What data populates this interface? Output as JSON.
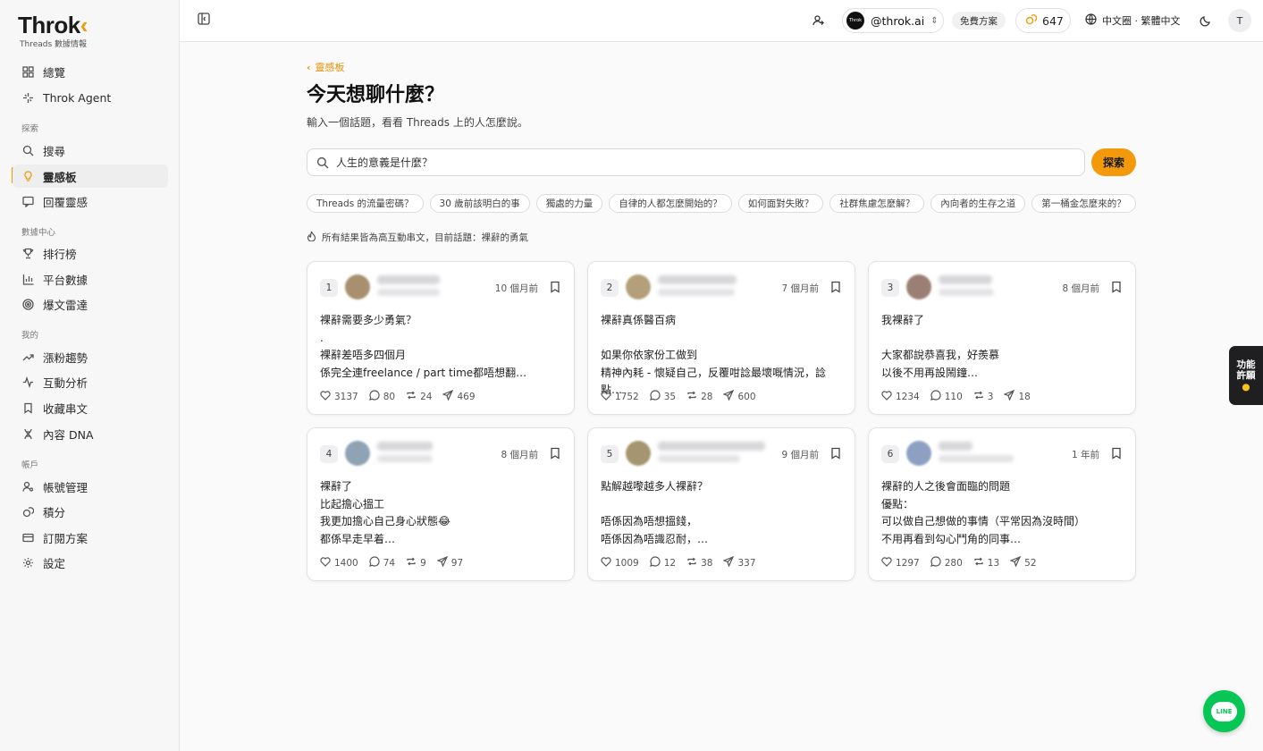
{
  "app": {
    "logo_main": "Throk",
    "logo_accent": "‹",
    "logo_sub": "Threads 數據情報"
  },
  "sidebar": {
    "top_items": [
      {
        "label": "總覽",
        "icon": "grid-icon"
      },
      {
        "label": "Throk Agent",
        "icon": "sparkle-icon"
      }
    ],
    "sections": [
      {
        "title": "探索",
        "items": [
          {
            "label": "搜尋",
            "icon": "search-icon"
          },
          {
            "label": "靈感板",
            "icon": "lightbulb-icon",
            "active": true
          },
          {
            "label": "回覆靈感",
            "icon": "reply-icon"
          }
        ]
      },
      {
        "title": "數據中心",
        "items": [
          {
            "label": "排行榜",
            "icon": "trophy-icon"
          },
          {
            "label": "平台數據",
            "icon": "bar-chart-icon"
          },
          {
            "label": "爆文雷達",
            "icon": "radar-icon"
          }
        ]
      },
      {
        "title": "我的",
        "items": [
          {
            "label": "漲粉趨勢",
            "icon": "trend-up-icon"
          },
          {
            "label": "互動分析",
            "icon": "activity-icon"
          },
          {
            "label": "收藏串文",
            "icon": "bookmark-icon"
          },
          {
            "label": "內容 DNA",
            "icon": "dna-icon"
          }
        ]
      },
      {
        "title": "帳戶",
        "items": [
          {
            "label": "帳號管理",
            "icon": "user-settings-icon"
          },
          {
            "label": "積分",
            "icon": "coins-icon"
          },
          {
            "label": "訂閱方案",
            "icon": "credit-card-icon"
          },
          {
            "label": "設定",
            "icon": "gear-icon"
          }
        ]
      }
    ]
  },
  "topbar": {
    "account_avatar_text": "Throk",
    "account_handle": "@throk.ai",
    "plan": "免費方案",
    "credits": "647",
    "language": "中文圈 · 繁體中文",
    "user_initial": "T"
  },
  "main": {
    "breadcrumb": "靈感板",
    "title": "今天想聊什麼？",
    "subtitle": "輸入一個話題，看看 Threads 上的人怎麼說。",
    "search_value": "人生的意義是什麼？",
    "search_button": "探索",
    "chips": [
      "Threads 的流量密碼？",
      "30 歲前該明白的事",
      "獨處的力量",
      "自律的人都怎麼開始的？",
      "如何面對失敗？",
      "社群焦慮怎麼解？",
      "內向者的生存之道",
      "第一桶金怎麼來的？"
    ],
    "note": "所有結果皆為高互動串文，目前話題：裸辭的勇氣"
  },
  "cards": [
    {
      "rank": "1",
      "time": "10 個月前",
      "text": "裸辭需要多少勇氣？\n.\n裸辭差唔多四個月\n係完全連freelance / part time都唔想翻…",
      "likes": "3137",
      "comments": "80",
      "reposts": "24",
      "shares": "469",
      "avatar_color": "#a88f6e"
    },
    {
      "rank": "2",
      "time": "7 個月前",
      "text": "裸辭真係醫百病\n\n如果你依家份工做到\n精神內耗 - 懷疑自己，反覆咁諗最壞嘅情況，諗點…",
      "likes": "1752",
      "comments": "35",
      "reposts": "28",
      "shares": "600",
      "avatar_color": "#b3a07a"
    },
    {
      "rank": "3",
      "time": "8 個月前",
      "text": "我裸辭了\n\n大家都說恭喜我，好羨慕\n以後不用再設鬧鐘…",
      "likes": "1234",
      "comments": "110",
      "reposts": "3",
      "shares": "18",
      "avatar_color": "#9c7f74"
    },
    {
      "rank": "4",
      "time": "8 個月前",
      "text": "裸辭了\n比起擔心搵工\n我更加擔心自己身心狀態😂\n都係早走早着…",
      "likes": "1400",
      "comments": "74",
      "reposts": "9",
      "shares": "97",
      "avatar_color": "#8fa3b5"
    },
    {
      "rank": "5",
      "time": "9 個月前",
      "text": "點解越嚟越多人裸辭？\n\n唔係因為唔想搵錢，\n唔係因為唔識忍耐，…",
      "likes": "1009",
      "comments": "12",
      "reposts": "38",
      "shares": "337",
      "avatar_color": "#a59570"
    },
    {
      "rank": "6",
      "time": "1 年前",
      "text": "裸辭的人之後會面臨的問題\n優點：\n可以做自己想做的事情（平常因為沒時間）\n不用再看到勾心鬥角的同事…",
      "likes": "1297",
      "comments": "280",
      "reposts": "13",
      "shares": "52",
      "avatar_color": "#8ea0c2"
    }
  ],
  "floating": {
    "feature_label_1": "功能",
    "feature_label_2": "許願",
    "line_label": "LINE"
  },
  "colors": {
    "accent": "#f29a0b",
    "line_green": "#06c755"
  }
}
